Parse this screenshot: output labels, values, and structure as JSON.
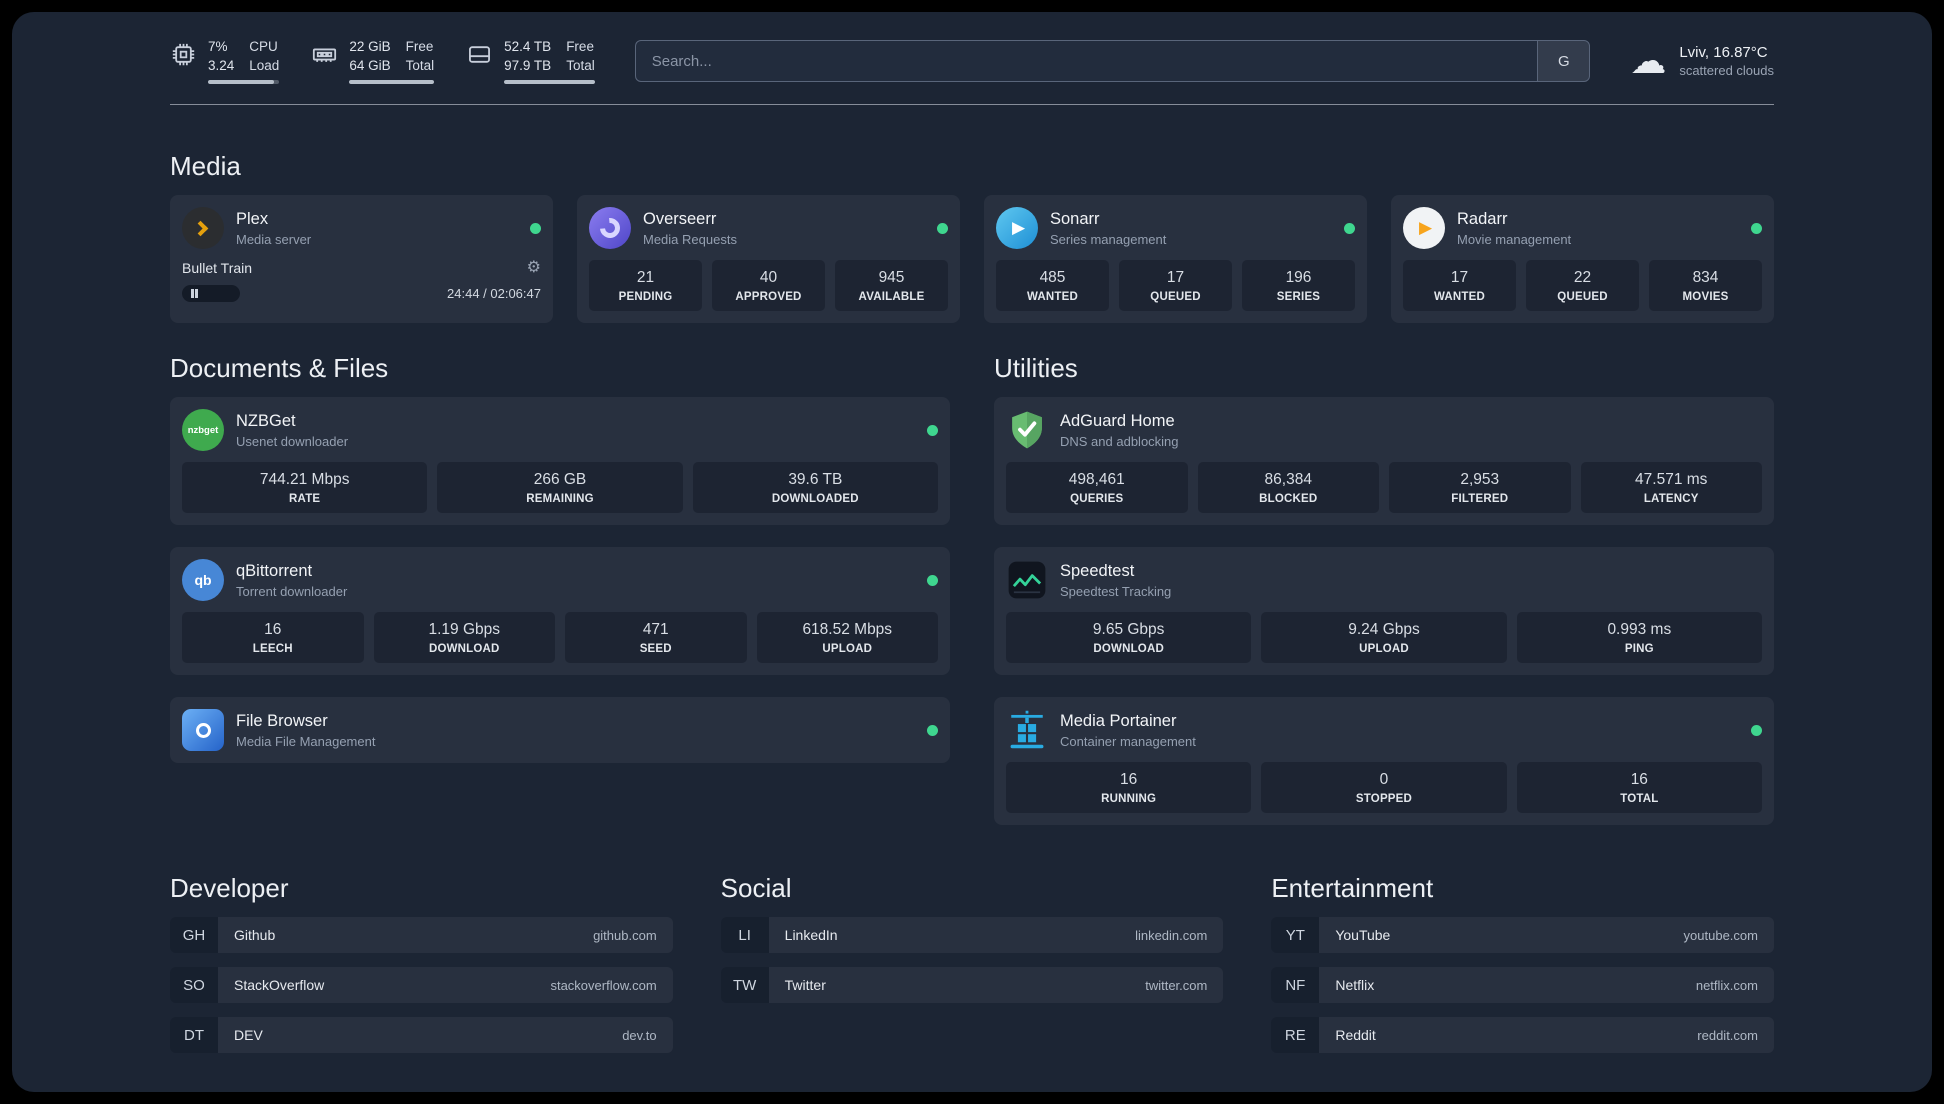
{
  "colors": {
    "status_online": "#3fd68f",
    "plex_amber": "#e5a00d",
    "radarr_amber": "#f7a41d",
    "nzbget_green": "#3faa4e",
    "qbit_blue": "#4787d6"
  },
  "icons": {
    "gear": "⚙",
    "cloud": "☁",
    "play": "▶"
  },
  "topbar": {
    "cpu": {
      "usage": "7%",
      "load": "3.24",
      "label_top": "CPU",
      "label_bottom": "Load"
    },
    "memory": {
      "free": "22 GiB",
      "total": "64 GiB",
      "label_top": "Free",
      "label_bottom": "Total"
    },
    "disk": {
      "free": "52.4 TB",
      "total": "97.9 TB",
      "label_top": "Free",
      "label_bottom": "Total"
    },
    "search": {
      "placeholder": "Search...",
      "engine_label": "G"
    },
    "weather": {
      "location": "Lviv, 16.87°C",
      "condition": "scattered clouds"
    }
  },
  "sections": {
    "media": "Media",
    "documents": "Documents & Files",
    "utilities": "Utilities",
    "developer": "Developer",
    "social": "Social",
    "entertainment": "Entertainment"
  },
  "services": {
    "plex": {
      "name": "Plex",
      "subtitle": "Media server",
      "now_playing": "Bullet Train",
      "time": "24:44 / 02:06:47"
    },
    "overseerr": {
      "name": "Overseerr",
      "subtitle": "Media Requests",
      "stats": [
        {
          "value": "21",
          "label": "PENDING"
        },
        {
          "value": "40",
          "label": "APPROVED"
        },
        {
          "value": "945",
          "label": "AVAILABLE"
        }
      ]
    },
    "sonarr": {
      "name": "Sonarr",
      "subtitle": "Series management",
      "stats": [
        {
          "value": "485",
          "label": "WANTED"
        },
        {
          "value": "17",
          "label": "QUEUED"
        },
        {
          "value": "196",
          "label": "SERIES"
        }
      ]
    },
    "radarr": {
      "name": "Radarr",
      "subtitle": "Movie management",
      "stats": [
        {
          "value": "17",
          "label": "WANTED"
        },
        {
          "value": "22",
          "label": "QUEUED"
        },
        {
          "value": "834",
          "label": "MOVIES"
        }
      ]
    },
    "nzbget": {
      "name": "NZBGet",
      "subtitle": "Usenet downloader",
      "icon_text": "nzbget",
      "stats": [
        {
          "value": "744.21 Mbps",
          "label": "RATE"
        },
        {
          "value": "266 GB",
          "label": "REMAINING"
        },
        {
          "value": "39.6 TB",
          "label": "DOWNLOADED"
        }
      ]
    },
    "qbittorrent": {
      "name": "qBittorrent",
      "subtitle": "Torrent downloader",
      "icon_text": "qb",
      "stats": [
        {
          "value": "16",
          "label": "LEECH"
        },
        {
          "value": "1.19 Gbps",
          "label": "DOWNLOAD"
        },
        {
          "value": "471",
          "label": "SEED"
        },
        {
          "value": "618.52 Mbps",
          "label": "UPLOAD"
        }
      ]
    },
    "filebrowser": {
      "name": "File Browser",
      "subtitle": "Media File Management"
    },
    "adguard": {
      "name": "AdGuard Home",
      "subtitle": "DNS and adblocking",
      "stats": [
        {
          "value": "498,461",
          "label": "QUERIES"
        },
        {
          "value": "86,384",
          "label": "BLOCKED"
        },
        {
          "value": "2,953",
          "label": "FILTERED"
        },
        {
          "value": "47.571 ms",
          "label": "LATENCY"
        }
      ]
    },
    "speedtest": {
      "name": "Speedtest",
      "subtitle": "Speedtest Tracking",
      "stats": [
        {
          "value": "9.65 Gbps",
          "label": "DOWNLOAD"
        },
        {
          "value": "9.24 Gbps",
          "label": "UPLOAD"
        },
        {
          "value": "0.993 ms",
          "label": "PING"
        }
      ]
    },
    "portainer": {
      "name": "Media Portainer",
      "subtitle": "Container management",
      "stats": [
        {
          "value": "16",
          "label": "RUNNING"
        },
        {
          "value": "0",
          "label": "STOPPED"
        },
        {
          "value": "16",
          "label": "TOTAL"
        }
      ]
    }
  },
  "bookmarks": {
    "developer": [
      {
        "abbr": "GH",
        "name": "Github",
        "domain": "github.com"
      },
      {
        "abbr": "SO",
        "name": "StackOverflow",
        "domain": "stackoverflow.com"
      },
      {
        "abbr": "DT",
        "name": "DEV",
        "domain": "dev.to"
      }
    ],
    "social": [
      {
        "abbr": "LI",
        "name": "LinkedIn",
        "domain": "linkedin.com"
      },
      {
        "abbr": "TW",
        "name": "Twitter",
        "domain": "twitter.com"
      }
    ],
    "entertainment": [
      {
        "abbr": "YT",
        "name": "YouTube",
        "domain": "youtube.com"
      },
      {
        "abbr": "NF",
        "name": "Netflix",
        "domain": "netflix.com"
      },
      {
        "abbr": "RE",
        "name": "Reddit",
        "domain": "reddit.com"
      }
    ]
  }
}
